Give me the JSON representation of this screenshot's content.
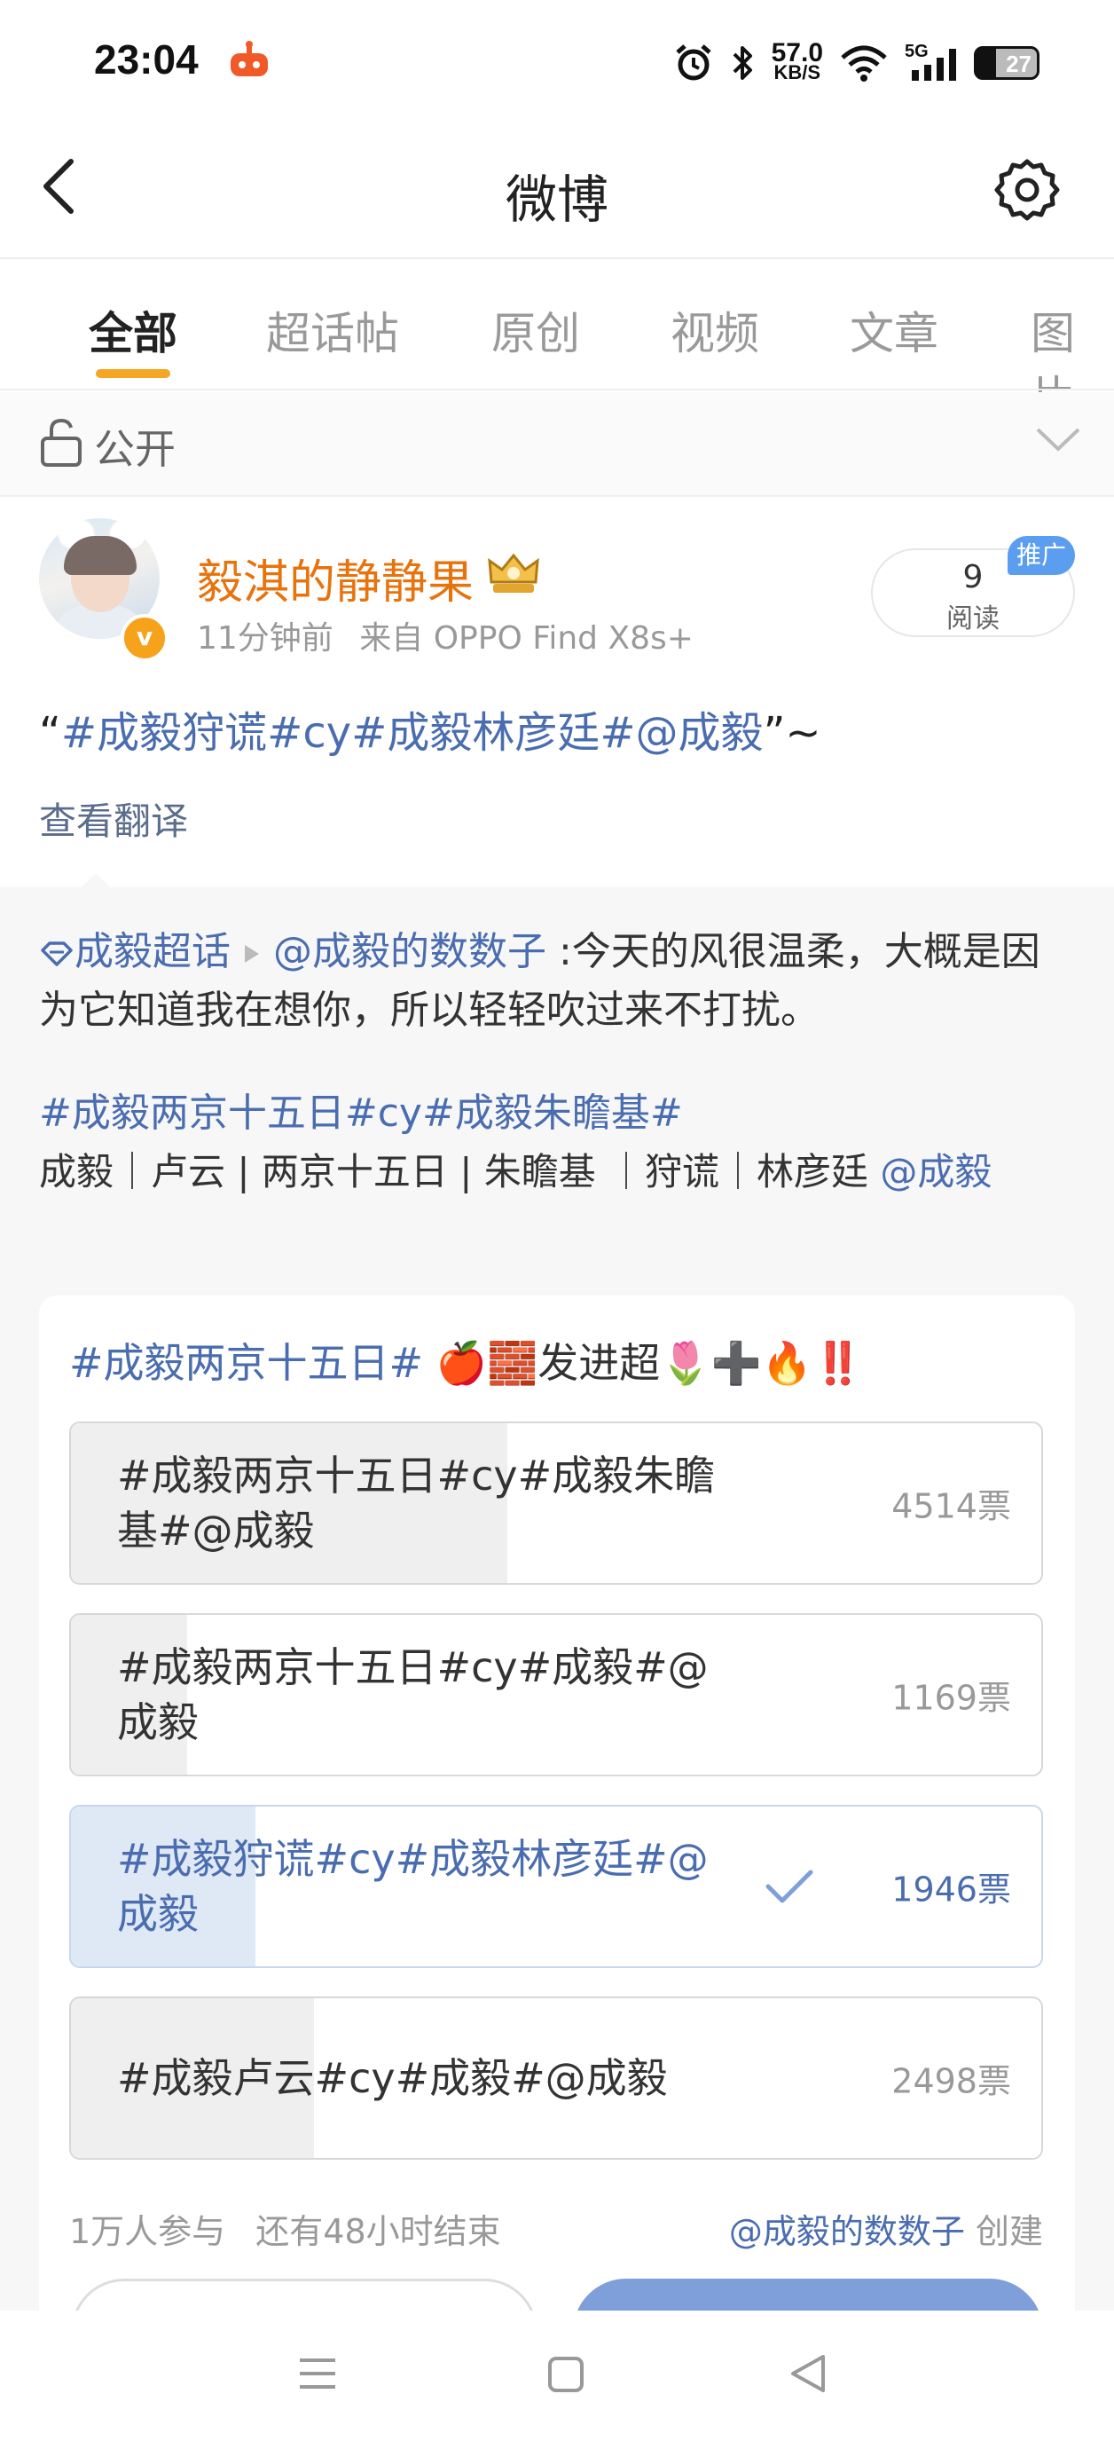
{
  "status_bar": {
    "time": "23:04",
    "net_speed_value": "57.0",
    "net_speed_unit": "KB/S",
    "network": "5G",
    "battery": "27",
    "icons": [
      "alarm-icon",
      "bluetooth-icon",
      "wifi-icon",
      "signal-icon"
    ]
  },
  "header": {
    "title": "微博",
    "back_icon": "chevron-left-icon",
    "settings_icon": "gear-icon"
  },
  "tabs": [
    {
      "label": "全部",
      "active": true
    },
    {
      "label": "超话帖",
      "active": false
    },
    {
      "label": "原创",
      "active": false
    },
    {
      "label": "视频",
      "active": false
    },
    {
      "label": "文章",
      "active": false
    },
    {
      "label": "图片",
      "active": false
    }
  ],
  "visibility": {
    "label": "公开"
  },
  "post": {
    "username": "毅淇的静静果",
    "time": "11分钟前",
    "source": "来自 OPPO Find X8s+",
    "read_count": "9",
    "read_label": "阅读",
    "promo": "推广",
    "text_open": "“",
    "text_tags": "#成毅狩谎#cy#成毅林彦廷#@成毅",
    "text_close": "”~",
    "translate": "查看翻译"
  },
  "repost": {
    "super_topic": "成毅超话",
    "author": "@成毅的数数子",
    "body": " :今天的风很温柔，大概是因为它知道我在想你，所以轻轻吹过来不打扰。",
    "tags": "#成毅两京十五日#cy#成毅朱瞻基#",
    "roles": "成毅｜卢云 | 两京十五日 | 朱瞻基 ｜狩谎｜林彦廷",
    "mention": " @成毅"
  },
  "poll": {
    "title_tag": "#成毅两京十五日#",
    "title_suffix": " 🍎🧱发进超🌷➕🔥‼️",
    "options": [
      {
        "text": "#成毅两京十五日#cy#成毅朱瞻基#@成毅",
        "votes": "4514票",
        "share": 0.45,
        "selected": false
      },
      {
        "text": "#成毅两京十五日#cy#成毅#@成毅",
        "votes": "1169票",
        "share": 0.12,
        "selected": false
      },
      {
        "text": "#成毅狩谎#cy#成毅林彦廷#@成毅",
        "votes": "1946票",
        "share": 0.19,
        "selected": true
      },
      {
        "text": "#成毅卢云#cy#成毅#@成毅",
        "votes": "2498票",
        "share": 0.25,
        "selected": false
      }
    ],
    "participants": "1万人参与",
    "remaining": "还有48小时结束",
    "creator": "@成毅的数数子",
    "created_label": " 创建"
  },
  "colors": {
    "accent": "#f5a623",
    "username": "#e8730d",
    "link": "#4a6db0",
    "selected_fill": "#dfe8f5"
  }
}
